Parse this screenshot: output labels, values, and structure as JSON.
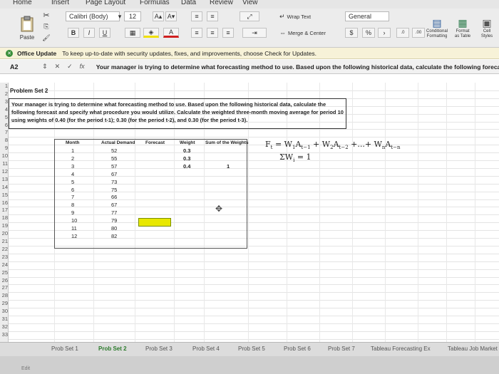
{
  "menu": {
    "home": "Home",
    "insert": "Insert",
    "page_layout": "Page Layout",
    "formulas": "Formulas",
    "data": "Data",
    "review": "Review",
    "view": "View"
  },
  "ribbon": {
    "paste": "Paste",
    "font_name": "Calibri (Body)",
    "font_size": "12",
    "bold": "B",
    "italic": "I",
    "underline": "U",
    "wrap_text": "Wrap Text",
    "merge_center": "Merge & Center",
    "number_format": "General",
    "dollar": "$",
    "percent": "%",
    "comma": "›",
    "conditional": "Conditional\nFormatting",
    "format_table": "Format\nas Table",
    "cell_styles": "Cell\nStyles"
  },
  "notification": {
    "title": "Office Update",
    "message": "To keep up-to-date with security updates, fixes, and improvements, choose Check for Updates."
  },
  "formula_bar": {
    "name_box": "A2",
    "content": "Your manager is trying to determine what forecasting method to use. Based upon the following historical data, calculate the following forecast a"
  },
  "columns": [
    "A",
    "B",
    "C",
    "D",
    "E",
    "F",
    "G",
    "H",
    "I",
    "J",
    "K",
    "L",
    "M",
    "N"
  ],
  "rows": [
    "1",
    "2",
    "3",
    "4",
    "5",
    "6",
    "7",
    "8",
    "9",
    "10",
    "11",
    "12",
    "13",
    "14",
    "15",
    "16",
    "17",
    "18",
    "19",
    "20",
    "21",
    "22",
    "23",
    "24",
    "25",
    "26",
    "27",
    "28",
    "29",
    "30",
    "31",
    "32",
    "33"
  ],
  "sheet": {
    "problem_title": "Problem Set 2",
    "problem_text": "Your manager is trying to determine what forecasting method to use. Based upon the following historical data, calculate the following forecast and specify what procedure you would utilize. Calculate the weighted three-month moving average for period 10 using weights of 0.40 (for the period t-1); 0.30 (for the period t-2), and 0.30 (for the period t-3).",
    "headers": {
      "month": "Month",
      "demand": "Actual Demand",
      "forecast": "Forecast",
      "weight": "Weight",
      "sum": "Sum of the Weights"
    },
    "months": [
      "1",
      "2",
      "3",
      "4",
      "5",
      "6",
      "7",
      "8",
      "9",
      "10",
      "11",
      "12"
    ],
    "demand": [
      "52",
      "55",
      "57",
      "67",
      "73",
      "75",
      "66",
      "67",
      "77",
      "79",
      "80",
      "82"
    ],
    "weights": [
      "0.3",
      "0.3",
      "0.4"
    ],
    "sum_value": "1",
    "formula_line1": "F",
    "formula_line2": "ΣW"
  },
  "sheet_tabs": [
    "Prob Set 1",
    "Prob Set 2",
    "Prob Set 3",
    "Prob Set 4",
    "Prob Set 5",
    "Prob Set 6",
    "Prob Set 7",
    "Tableau Forecasting Ex",
    "Tableau Job Market"
  ],
  "status": {
    "mode": "Edit"
  },
  "colors": {
    "accent": "#217346",
    "selected": "#e8e800"
  }
}
